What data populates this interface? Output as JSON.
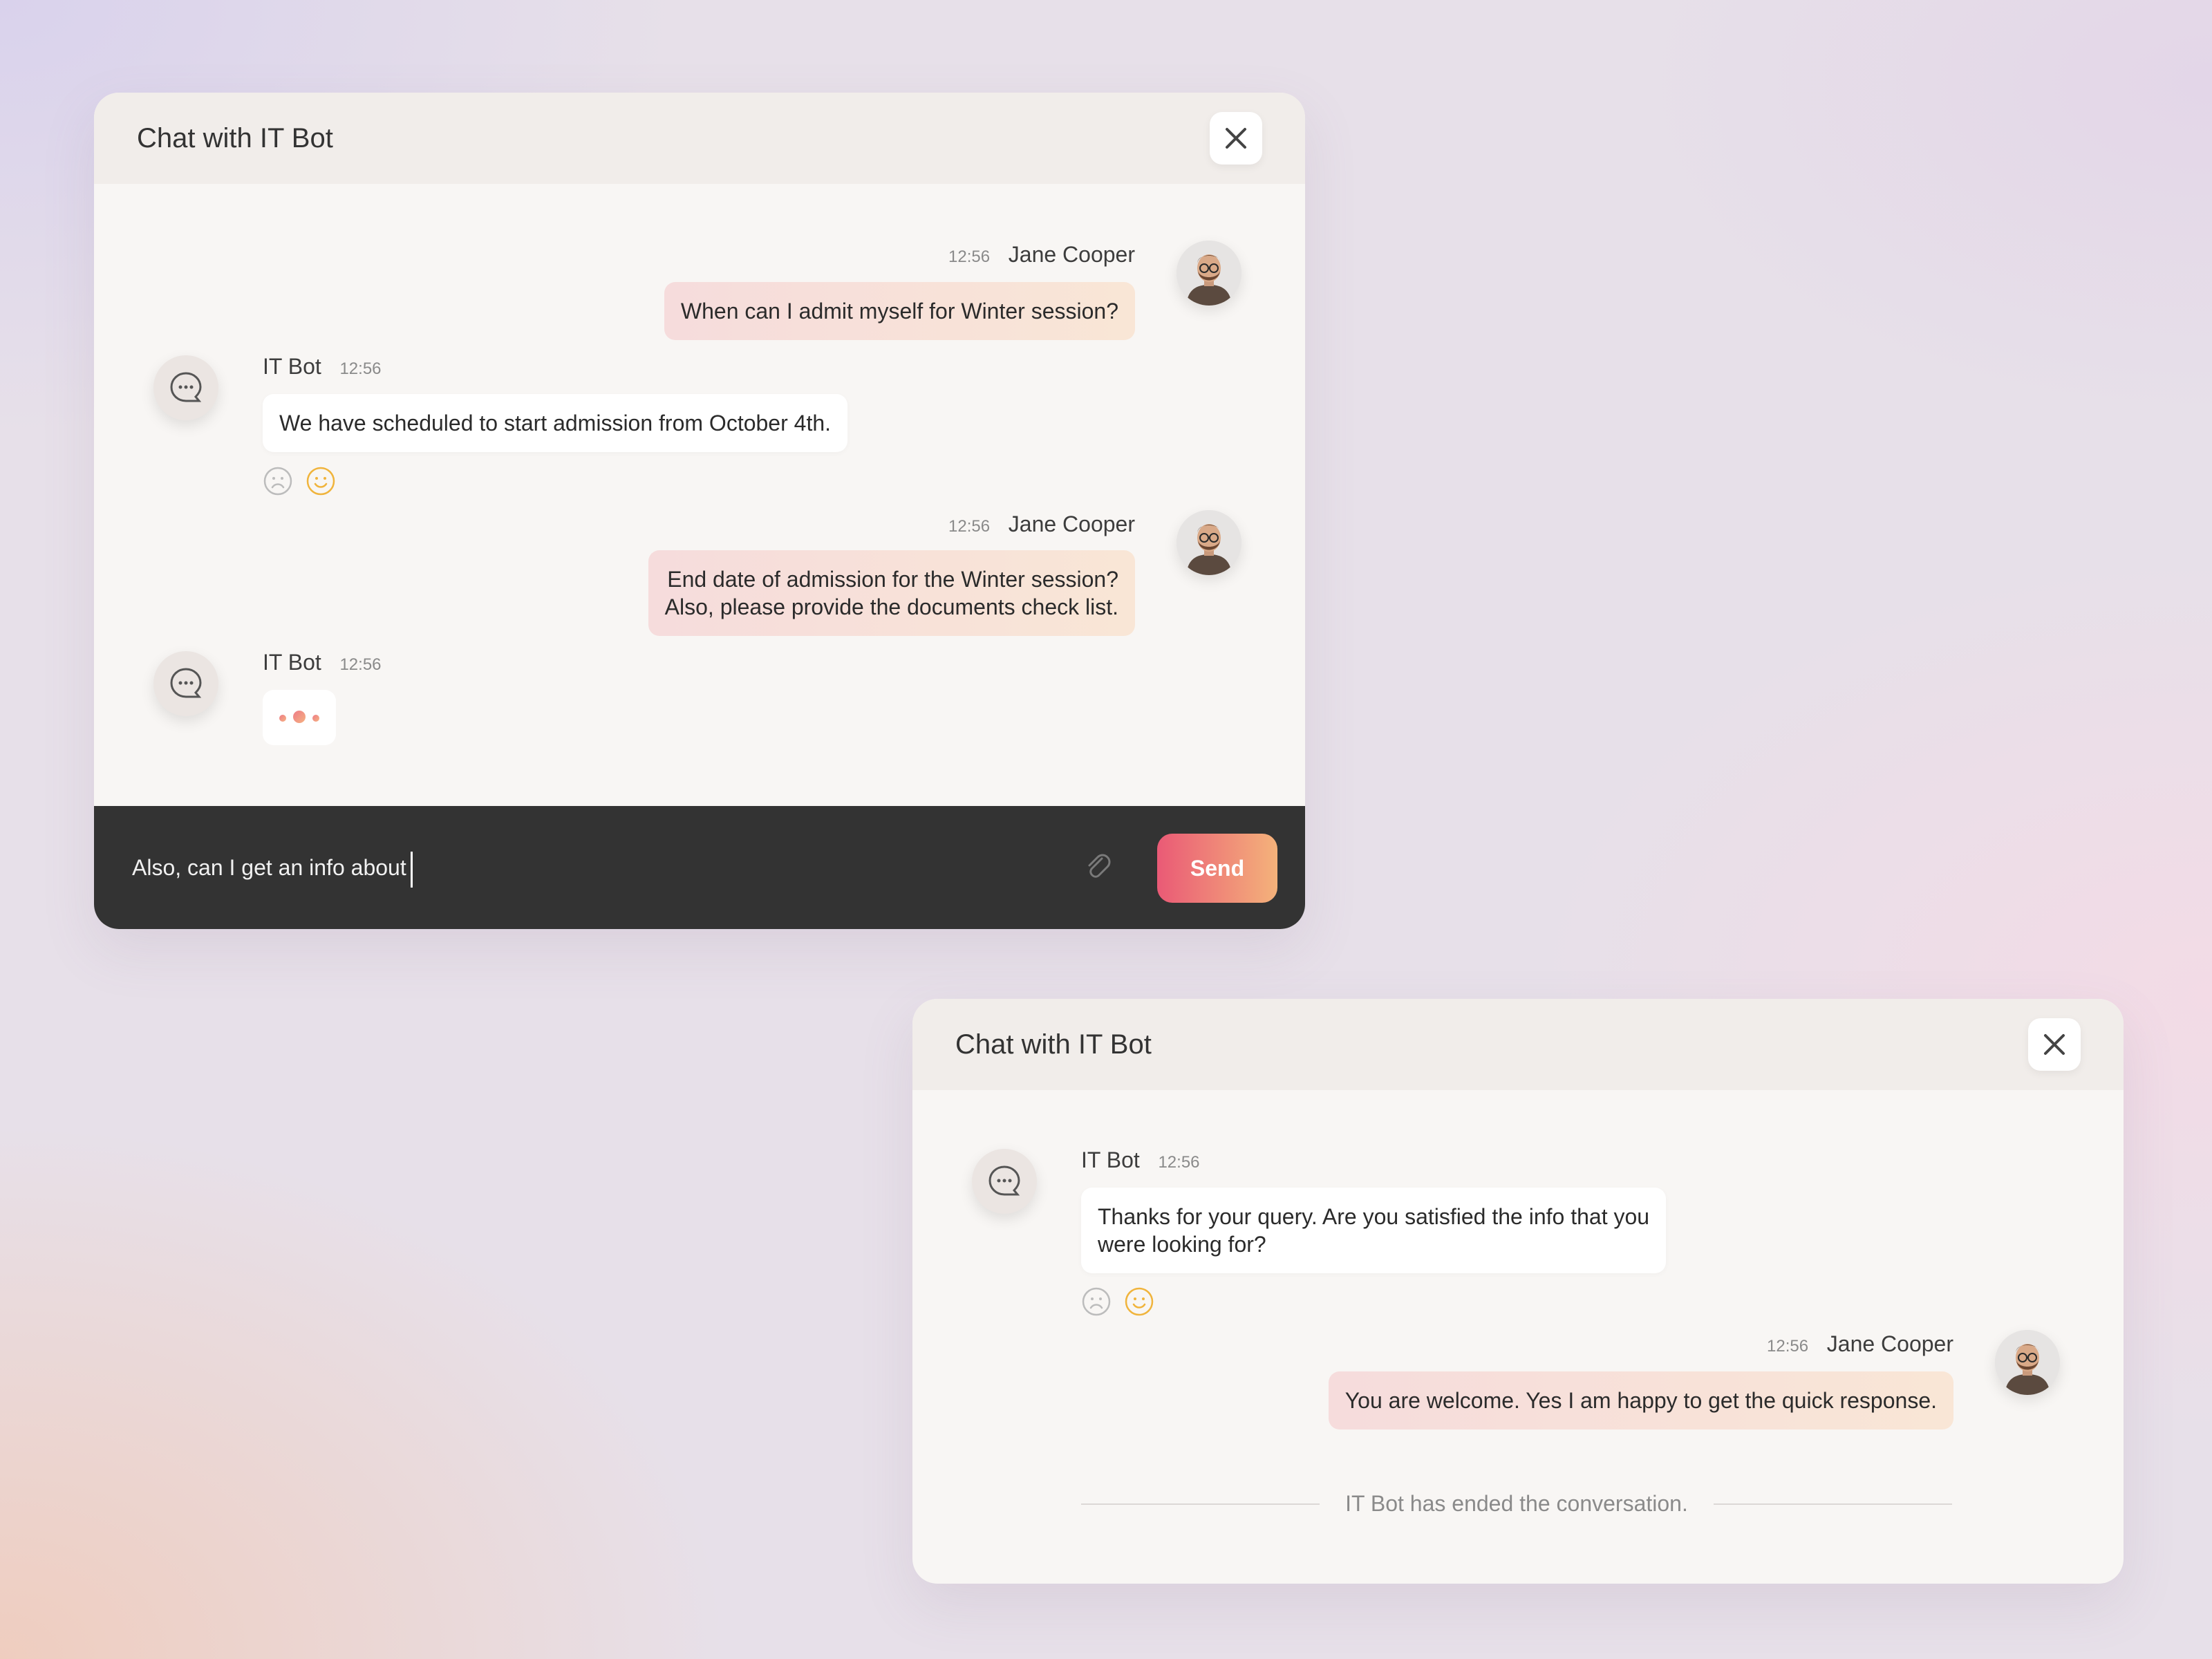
{
  "window1": {
    "title": "Chat with IT Bot",
    "messages": [
      {
        "sender": "Jane Cooper",
        "time": "12:56",
        "lines": [
          "When can I admit myself for Winter session?"
        ]
      },
      {
        "sender": "IT Bot",
        "time": "12:56",
        "lines": [
          "We have scheduled to start admission from October 4th."
        ]
      },
      {
        "sender": "Jane Cooper",
        "time": "12:56",
        "lines": [
          "End date of admission for the Winter session?",
          "Also, please provide the documents check list."
        ]
      },
      {
        "sender": "IT Bot",
        "time": "12:56",
        "typing": true
      }
    ],
    "composer": {
      "value": "Also, can I get an info about",
      "send_label": "Send"
    }
  },
  "window2": {
    "title": "Chat with IT Bot",
    "messages": [
      {
        "sender": "IT Bot",
        "time": "12:56",
        "lines": [
          "Thanks for your query. Are you satisfied the info that you",
          "were looking for?"
        ]
      },
      {
        "sender": "Jane Cooper",
        "time": "12:56",
        "lines": [
          "You are welcome. Yes I am happy to get the quick response."
        ]
      }
    ],
    "ended_text": "IT Bot has ended the conversation."
  },
  "icons": {
    "close": "close-icon",
    "bot": "chat-bubble-icon",
    "sad": "sad-face-icon",
    "happy": "happy-face-icon",
    "attach": "paperclip-icon",
    "avatar": "user-avatar"
  },
  "colors": {
    "send_gradient_start": "#ea5a76",
    "send_gradient_end": "#f4b27a",
    "happy_icon": "#f0b43c",
    "composer_bg": "#333333"
  }
}
